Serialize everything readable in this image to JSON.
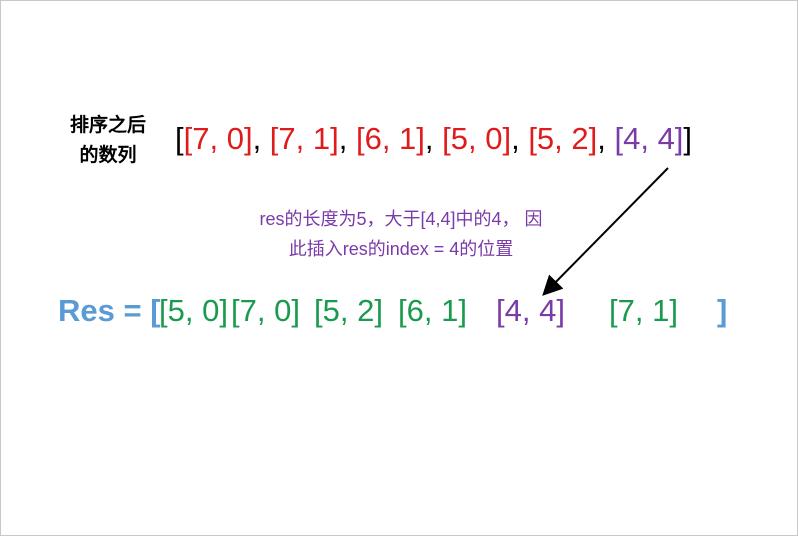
{
  "sorted_label_line1": "排序之后",
  "sorted_label_line2": "的数列",
  "sorted_array": {
    "open": "[",
    "items": [
      "[7, 0]",
      "[7, 1]",
      "[6, 1]",
      "[5, 0]",
      "[5, 2]",
      "[4, 4]"
    ],
    "separator": ", ",
    "close": "]"
  },
  "note_line1": "res的长度为5，大于[4,4]中的4， 因",
  "note_line2": "此插入res的index = 4的位置",
  "res": {
    "label": "Res = [",
    "items": [
      "[5, 0]",
      "[7, 0]",
      "[5, 2]",
      "[6, 1]",
      "[4, 4]",
      "[7, 1]"
    ],
    "close": "]"
  },
  "colors": {
    "sorted_text": "#e01b1b",
    "highlight": "#7a3aa8",
    "res_label": "#5b9bd5",
    "res_items": "#1a9a4f"
  }
}
